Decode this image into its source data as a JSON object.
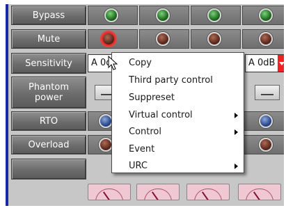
{
  "rows": {
    "bypass_label": "Bypass",
    "mute_label": "Mute",
    "sensitivity_label": "Sensitivity",
    "phantom_label_line1": "Phantom",
    "phantom_label_line2": "power",
    "rto_label": "RTO",
    "overload_label": "Overload"
  },
  "sensitivity": {
    "channel1_value": "A 0d",
    "channel4_value": "A 0dB"
  },
  "context_menu": {
    "items": [
      {
        "label": "Copy"
      },
      {
        "label": "Third party control"
      },
      {
        "label": "Suppreset"
      },
      {
        "label": "Virtual control"
      },
      {
        "label": "Control"
      },
      {
        "label": "Event"
      },
      {
        "label": "URC"
      }
    ]
  },
  "colors": {
    "panel_border": "#1a28a6",
    "led_green": "#1f6b1f",
    "led_active_ring": "#e82a2a",
    "select_arrow": "#ee2222"
  },
  "icons": {
    "cursor": "arrow-pointer-icon",
    "submenu": "chevron-right-icon"
  }
}
